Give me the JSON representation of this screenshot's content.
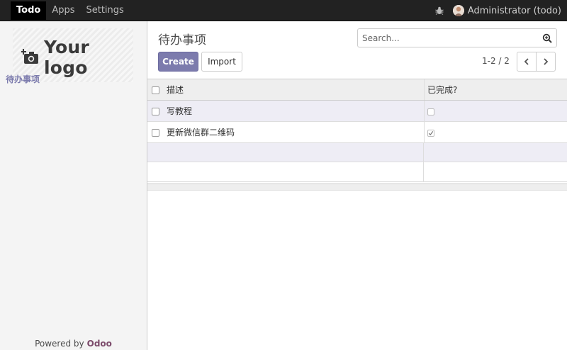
{
  "topbar": {
    "nav": [
      "Todo",
      "Apps",
      "Settings"
    ],
    "user": "Administrator (todo)",
    "bug_icon": "bug-icon",
    "avatar_icon": "user-avatar"
  },
  "sidebar": {
    "logo_text": "Your logo",
    "logo_icon": "camera-plus-icon",
    "menu_item": "待办事项",
    "powered_prefix": "Powered by",
    "powered_brand": "Odoo"
  },
  "control_panel": {
    "title": "待办事项",
    "search_placeholder": "Search...",
    "create_label": "Create",
    "import_label": "Import",
    "pager_text": "1-2 / 2"
  },
  "list": {
    "columns": [
      "描述",
      "已完成?"
    ],
    "rows": [
      {
        "desc": "写教程",
        "done": false
      },
      {
        "desc": "更新微信群二维码",
        "done": true
      }
    ]
  },
  "colors": {
    "accent": "#7c7bad",
    "topbar": "#222222",
    "brand": "#7c4b6b",
    "row_highlight": "#eeedf5"
  }
}
